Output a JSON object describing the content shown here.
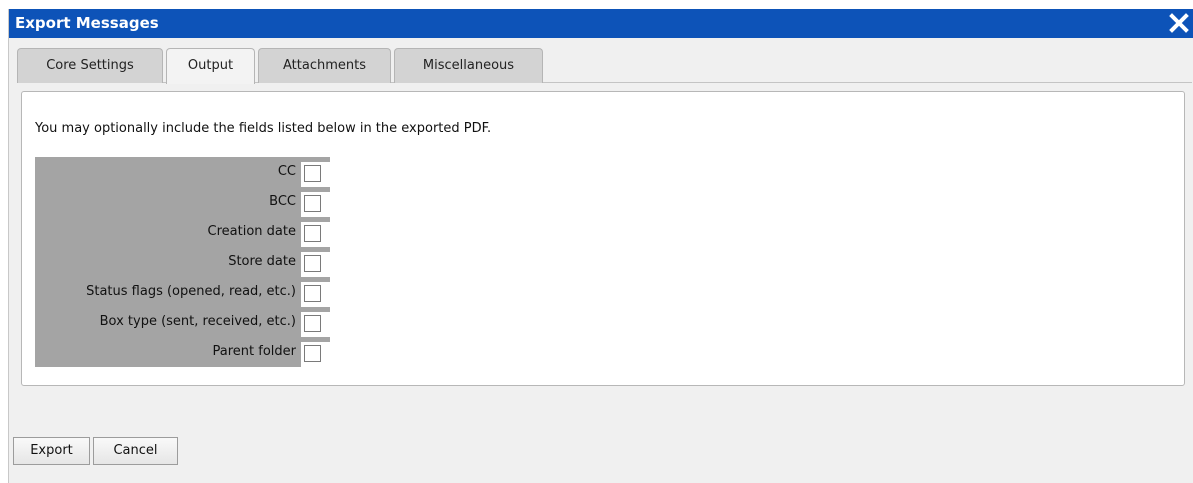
{
  "window": {
    "title": "Export Messages",
    "close_icon": "close-icon"
  },
  "tabs": [
    {
      "label": "Core Settings",
      "active": false
    },
    {
      "label": "Output",
      "active": true
    },
    {
      "label": "Attachments",
      "active": false
    },
    {
      "label": "Miscellaneous",
      "active": false
    }
  ],
  "output": {
    "intro": "You may optionally include the fields listed below in the exported PDF.",
    "fields": [
      {
        "label": "CC",
        "checked": false
      },
      {
        "label": "BCC",
        "checked": false
      },
      {
        "label": "Creation date",
        "checked": false
      },
      {
        "label": "Store date",
        "checked": false
      },
      {
        "label": "Status flags (opened, read, etc.)",
        "checked": false
      },
      {
        "label": "Box type (sent, received, etc.)",
        "checked": false
      },
      {
        "label": "Parent folder",
        "checked": false
      }
    ]
  },
  "buttons": {
    "export_label": "Export",
    "cancel_label": "Cancel"
  },
  "colors": {
    "titlebar": "#0d53b8",
    "field_label_background": "#a4a4a4"
  }
}
